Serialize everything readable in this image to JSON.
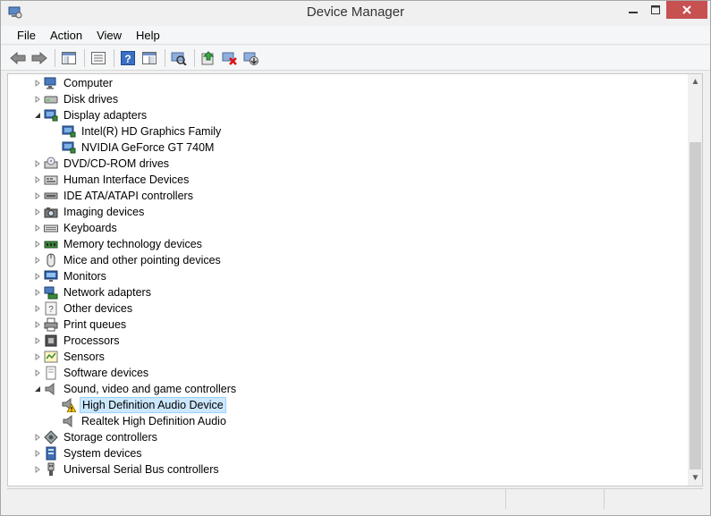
{
  "window": {
    "title": "Device Manager"
  },
  "menu": [
    "File",
    "Action",
    "View",
    "Help"
  ],
  "toolbar": {
    "buttons": [
      "back-icon",
      "forward-icon",
      "show-hide-console-tree-icon",
      "properties-icon",
      "help-icon",
      "action-pane-icon",
      "scan-hardware-icon",
      "update-driver-icon",
      "uninstall-icon",
      "disable-device-icon"
    ]
  },
  "tree": {
    "items": [
      {
        "label": "Computer",
        "level": 0,
        "expanded": false,
        "icon": "computer-icon"
      },
      {
        "label": "Disk drives",
        "level": 0,
        "expanded": false,
        "icon": "disk-drive-icon"
      },
      {
        "label": "Display adapters",
        "level": 0,
        "expanded": true,
        "icon": "display-adapter-icon"
      },
      {
        "label": "Intel(R) HD Graphics Family",
        "level": 1,
        "icon": "display-adapter-icon"
      },
      {
        "label": "NVIDIA GeForce GT 740M",
        "level": 1,
        "icon": "display-adapter-icon"
      },
      {
        "label": "DVD/CD-ROM drives",
        "level": 0,
        "expanded": false,
        "icon": "dvd-drive-icon"
      },
      {
        "label": "Human Interface Devices",
        "level": 0,
        "expanded": false,
        "icon": "hid-icon"
      },
      {
        "label": "IDE ATA/ATAPI controllers",
        "level": 0,
        "expanded": false,
        "icon": "ide-controller-icon"
      },
      {
        "label": "Imaging devices",
        "level": 0,
        "expanded": false,
        "icon": "camera-icon"
      },
      {
        "label": "Keyboards",
        "level": 0,
        "expanded": false,
        "icon": "keyboard-icon"
      },
      {
        "label": "Memory technology devices",
        "level": 0,
        "expanded": false,
        "icon": "memory-icon"
      },
      {
        "label": "Mice and other pointing devices",
        "level": 0,
        "expanded": false,
        "icon": "mouse-icon"
      },
      {
        "label": "Monitors",
        "level": 0,
        "expanded": false,
        "icon": "monitor-icon"
      },
      {
        "label": "Network adapters",
        "level": 0,
        "expanded": false,
        "icon": "network-icon"
      },
      {
        "label": "Other devices",
        "level": 0,
        "expanded": false,
        "icon": "other-devices-icon"
      },
      {
        "label": "Print queues",
        "level": 0,
        "expanded": false,
        "icon": "printer-icon"
      },
      {
        "label": "Processors",
        "level": 0,
        "expanded": false,
        "icon": "processor-icon"
      },
      {
        "label": "Sensors",
        "level": 0,
        "expanded": false,
        "icon": "sensor-icon"
      },
      {
        "label": "Software devices",
        "level": 0,
        "expanded": false,
        "icon": "software-device-icon"
      },
      {
        "label": "Sound, video and game controllers",
        "level": 0,
        "expanded": true,
        "icon": "speaker-icon"
      },
      {
        "label": "High Definition Audio Device",
        "level": 1,
        "icon": "speaker-warning-icon",
        "selected": true
      },
      {
        "label": "Realtek High Definition Audio",
        "level": 1,
        "icon": "speaker-icon"
      },
      {
        "label": "Storage controllers",
        "level": 0,
        "expanded": false,
        "icon": "storage-controller-icon"
      },
      {
        "label": "System devices",
        "level": 0,
        "expanded": false,
        "icon": "system-device-icon"
      },
      {
        "label": "Universal Serial Bus controllers",
        "level": 0,
        "expanded": false,
        "icon": "usb-icon"
      }
    ]
  },
  "colors": {
    "selection_bg": "#cce8ff",
    "selection_border": "#99d1ff",
    "close_button": "#c75050",
    "warning": "#f5c211"
  }
}
